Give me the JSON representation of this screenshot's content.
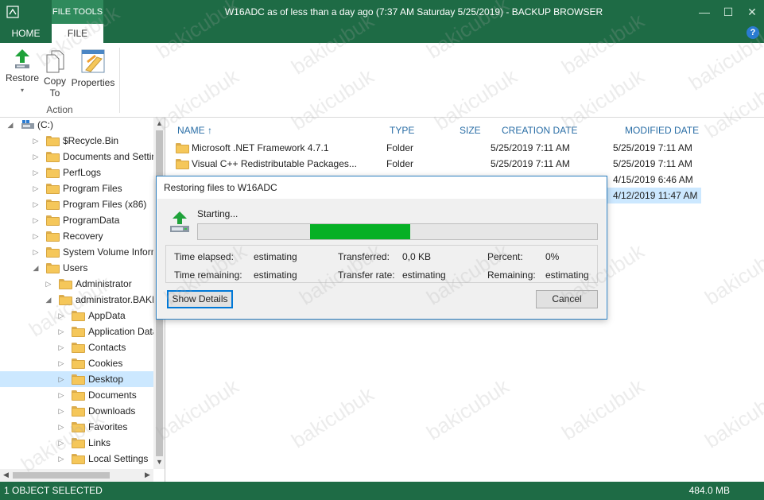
{
  "window": {
    "title": "W16ADC as of less than a day ago (7:37 AM Saturday 5/25/2019) - BACKUP BROWSER",
    "context_tab": "FILE TOOLS",
    "controls": {
      "minimize": "—",
      "maximize": "☐",
      "close": "✕"
    }
  },
  "ribbon": {
    "tabs": [
      "HOME",
      "FILE"
    ],
    "active_tab": "FILE",
    "help": "?",
    "buttons": {
      "restore": "Restore",
      "copy_line1": "Copy",
      "copy_line2": "To",
      "properties": "Properties"
    },
    "group_label": "Action"
  },
  "tree": {
    "root": "(C:)",
    "items": [
      {
        "label": "$Recycle.Bin"
      },
      {
        "label": "Documents and Settings"
      },
      {
        "label": "PerfLogs"
      },
      {
        "label": "Program Files"
      },
      {
        "label": "Program Files (x86)"
      },
      {
        "label": "ProgramData"
      },
      {
        "label": "Recovery"
      },
      {
        "label": "System Volume Informati"
      },
      {
        "label": "Users"
      },
      {
        "label": "Administrator"
      },
      {
        "label": "administrator.BAKICU"
      },
      {
        "label": "AppData"
      },
      {
        "label": "Application Data"
      },
      {
        "label": "Contacts"
      },
      {
        "label": "Cookies"
      },
      {
        "label": "Desktop"
      },
      {
        "label": "Documents"
      },
      {
        "label": "Downloads"
      },
      {
        "label": "Favorites"
      },
      {
        "label": "Links"
      },
      {
        "label": "Local Settings"
      }
    ]
  },
  "list": {
    "columns": {
      "name": "NAME",
      "sort_arrow": "↑",
      "type": "TYPE",
      "size": "SIZE",
      "created": "CREATION DATE",
      "modified": "MODIFIED DATE"
    },
    "rows": [
      {
        "name": "Microsoft .NET Framework 4.7.1",
        "type": "Folder",
        "size": "",
        "created": "5/25/2019 7:11 AM",
        "modified": "5/25/2019 7:11 AM"
      },
      {
        "name": "Visual  C++  Redistributable  Packages...",
        "type": "Folder",
        "size": "",
        "created": "5/25/2019 7:11 AM",
        "modified": "5/25/2019 7:11 AM"
      },
      {
        "name": "",
        "type": "",
        "size": "",
        "created": "",
        "modified": "4/15/2019 6:46 AM"
      },
      {
        "name": "",
        "type": "",
        "size": "",
        "created": "",
        "modified": "4/12/2019 11:47 AM"
      }
    ]
  },
  "dialog": {
    "title": "Restoring files to W16ADC",
    "status": "Starting...",
    "progress": {
      "start_fraction": 0.28,
      "end_fraction": 0.53
    },
    "stats": {
      "time_elapsed_label": "Time elapsed:",
      "time_elapsed": "estimating",
      "transferred_label": "Transferred:",
      "transferred": "0,0 KB",
      "percent_label": "Percent:",
      "percent": "0%",
      "time_remaining_label": "Time remaining:",
      "time_remaining": "estimating",
      "transfer_rate_label": "Transfer rate:",
      "transfer_rate": "estimating",
      "remaining_label": "Remaining:",
      "remaining": "estimating"
    },
    "show_details": "Show Details",
    "cancel": "Cancel"
  },
  "status": {
    "selection": "1 OBJECT SELECTED",
    "size": "484.0 MB"
  },
  "watermark": "bakicubuk",
  "colors": {
    "brand": "#1e6b45",
    "accent": "#2a6ea6",
    "progress": "#06b025",
    "selection": "#cce8ff"
  }
}
